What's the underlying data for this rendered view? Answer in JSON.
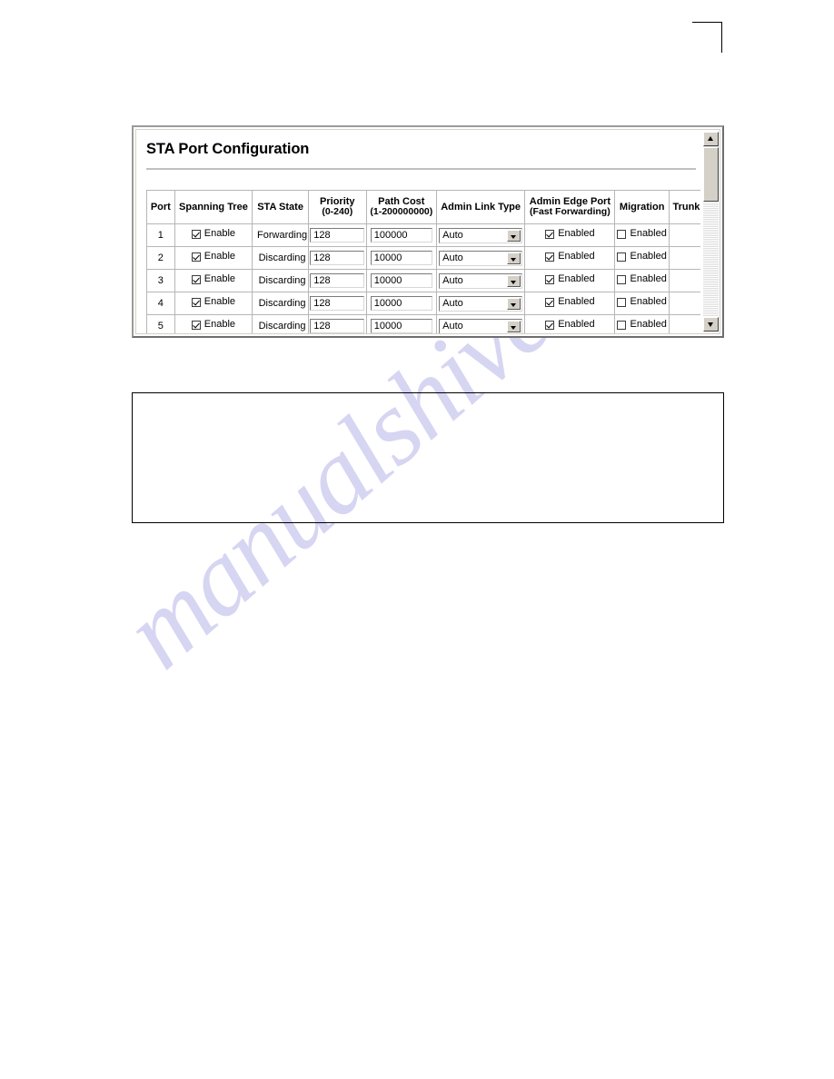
{
  "page": {
    "watermark_text": "manualshive.com",
    "crop_mark": "corner-crop-mark"
  },
  "panel": {
    "title": "STA Port Configuration",
    "scrollbar": {
      "up_arrow": "scroll-up-icon",
      "down_arrow": "scroll-down-icon",
      "thumb": "scroll-thumb"
    }
  },
  "table": {
    "headers": [
      {
        "main": "Port",
        "sub": ""
      },
      {
        "main": "Spanning Tree",
        "sub": ""
      },
      {
        "main": "STA State",
        "sub": ""
      },
      {
        "main": "Priority",
        "sub": "(0-240)"
      },
      {
        "main": "Path Cost",
        "sub": "(1-200000000)"
      },
      {
        "main": "Admin Link Type",
        "sub": ""
      },
      {
        "main": "Admin Edge Port",
        "sub": "(Fast Forwarding)"
      },
      {
        "main": "Migration",
        "sub": ""
      },
      {
        "main": "Trunk",
        "sub": ""
      }
    ],
    "rows": [
      {
        "port": "1",
        "spanning_tree_label": "Enable",
        "spanning_tree_checked": true,
        "sta_state": "Forwarding",
        "priority": "128",
        "path_cost": "100000",
        "admin_link_type": "Auto",
        "admin_edge_port_label": "Enabled",
        "admin_edge_port_checked": true,
        "migration_label": "Enabled",
        "migration_checked": false,
        "trunk": ""
      },
      {
        "port": "2",
        "spanning_tree_label": "Enable",
        "spanning_tree_checked": true,
        "sta_state": "Discarding",
        "priority": "128",
        "path_cost": "10000",
        "admin_link_type": "Auto",
        "admin_edge_port_label": "Enabled",
        "admin_edge_port_checked": true,
        "migration_label": "Enabled",
        "migration_checked": false,
        "trunk": ""
      },
      {
        "port": "3",
        "spanning_tree_label": "Enable",
        "spanning_tree_checked": true,
        "sta_state": "Discarding",
        "priority": "128",
        "path_cost": "10000",
        "admin_link_type": "Auto",
        "admin_edge_port_label": "Enabled",
        "admin_edge_port_checked": true,
        "migration_label": "Enabled",
        "migration_checked": false,
        "trunk": ""
      },
      {
        "port": "4",
        "spanning_tree_label": "Enable",
        "spanning_tree_checked": true,
        "sta_state": "Discarding",
        "priority": "128",
        "path_cost": "10000",
        "admin_link_type": "Auto",
        "admin_edge_port_label": "Enabled",
        "admin_edge_port_checked": true,
        "migration_label": "Enabled",
        "migration_checked": false,
        "trunk": ""
      },
      {
        "port": "5",
        "spanning_tree_label": "Enable",
        "spanning_tree_checked": true,
        "sta_state": "Discarding",
        "priority": "128",
        "path_cost": "10000",
        "admin_link_type": "Auto",
        "admin_edge_port_label": "Enabled",
        "admin_edge_port_checked": true,
        "migration_label": "Enabled",
        "migration_checked": false,
        "trunk": ""
      }
    ]
  },
  "note_box": {
    "text": ""
  }
}
